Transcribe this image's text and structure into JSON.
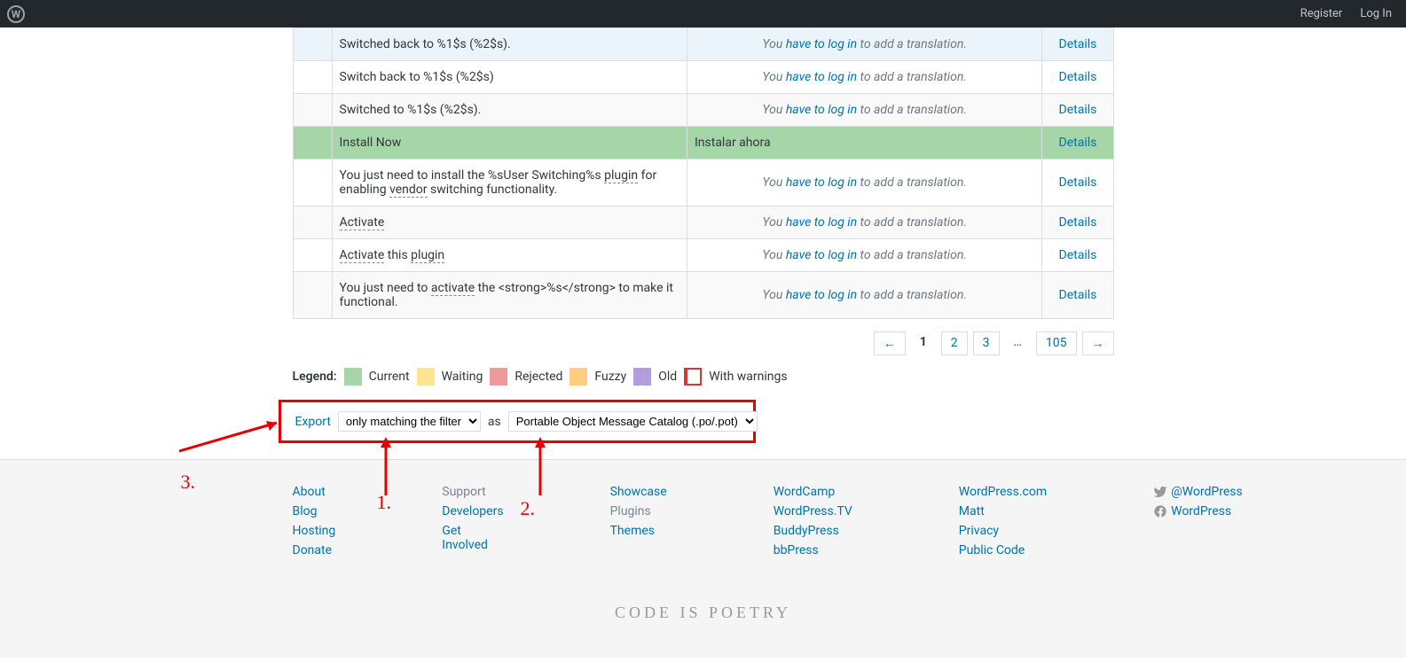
{
  "admin_bar": {
    "register": "Register",
    "login": "Log In"
  },
  "rows": [
    {
      "cls": "row-fuzzy",
      "source": [
        {
          "t": "Switched back to %1$s (%2$s)."
        }
      ],
      "trans": null,
      "details": "Details"
    },
    {
      "cls": "",
      "source": [
        {
          "t": "Switch back to %1$s (%2$s)"
        }
      ],
      "trans": null,
      "details": "Details"
    },
    {
      "cls": "row-alt",
      "source": [
        {
          "t": "Switched to %1$s (%2$s)."
        }
      ],
      "trans": null,
      "details": "Details"
    },
    {
      "cls": "row-current",
      "source": [
        {
          "t": "Install Now"
        }
      ],
      "trans": "Instalar ahora",
      "details": "Details"
    },
    {
      "cls": "",
      "source": [
        {
          "t": "You just need to install the %sUser Switching%s "
        },
        {
          "t": "plugin",
          "u": true
        },
        {
          "t": " for enabling "
        },
        {
          "t": "vendor",
          "u": true
        },
        {
          "t": " switching functionality."
        }
      ],
      "trans": null,
      "details": "Details"
    },
    {
      "cls": "row-alt",
      "source": [
        {
          "t": "Activate",
          "u": true
        }
      ],
      "trans": null,
      "details": "Details"
    },
    {
      "cls": "",
      "source": [
        {
          "t": "Activate",
          "u": true
        },
        {
          "t": " this "
        },
        {
          "t": "plugin",
          "u": true
        }
      ],
      "trans": null,
      "details": "Details"
    },
    {
      "cls": "row-alt",
      "source": [
        {
          "t": "You just need to "
        },
        {
          "t": "activate",
          "u": true
        },
        {
          "t": " the <strong>%s</strong> to make it functional."
        }
      ],
      "trans": null,
      "details": "Details"
    }
  ],
  "trans_prompt": {
    "prefix": "You ",
    "link": "have to log in",
    "suffix": " to add a translation."
  },
  "pagination": {
    "prev": "←",
    "current": "1",
    "p2": "2",
    "p3": "3",
    "dots": "…",
    "last": "105",
    "next": "→"
  },
  "legend": {
    "label": "Legend:",
    "current": "Current",
    "waiting": "Waiting",
    "rejected": "Rejected",
    "fuzzy": "Fuzzy",
    "old": "Old",
    "warnings": "With warnings"
  },
  "export": {
    "link": "Export",
    "filter_sel": "only matching the filter",
    "as": "as",
    "format_sel": "Portable Object Message Catalog (.po/.pot)"
  },
  "footer": {
    "col1": [
      "About",
      "Blog",
      "Hosting",
      "Donate"
    ],
    "col2": [
      "Support",
      "Developers",
      "Get Involved"
    ],
    "col3": [
      "Showcase",
      "Plugins",
      "Themes"
    ],
    "col4": [
      "WordCamp",
      "WordPress.TV",
      "BuddyPress",
      "bbPress"
    ],
    "col5": [
      "WordPress.com",
      "Matt",
      "Privacy",
      "Public Code"
    ],
    "social": {
      "twitter": "@WordPress",
      "fb": "WordPress"
    }
  },
  "tagline": "CODE IS POETRY",
  "annotations": {
    "l1": "1.",
    "l2": "2.",
    "l3": "3."
  }
}
